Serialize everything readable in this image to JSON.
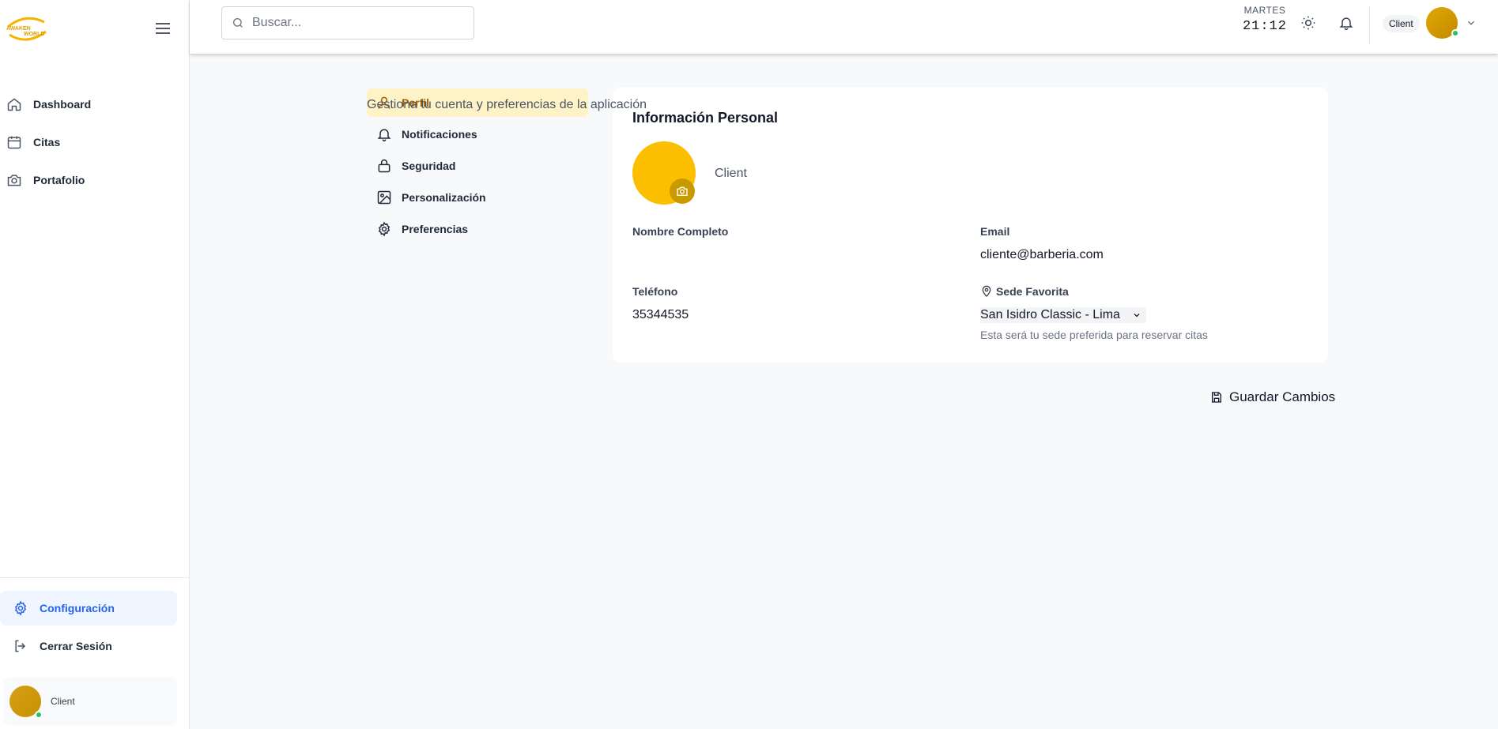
{
  "sidebar": {
    "logo_text": "AWAKEN WORLD",
    "items": [
      {
        "label": "Dashboard",
        "icon": "home-icon"
      },
      {
        "label": "Citas",
        "icon": "calendar-icon"
      },
      {
        "label": "Portafolio",
        "icon": "camera-icon"
      }
    ],
    "settings_label": "Configuración",
    "logout_label": "Cerrar Sesión",
    "user_name": "Client"
  },
  "header": {
    "search_placeholder": "Buscar...",
    "day": "MARTES",
    "time": "21:12",
    "role": "Client"
  },
  "page": {
    "subtitle": "Gestiona tu cuenta y preferencias de la aplicación"
  },
  "tabs": [
    {
      "label": "Perfil",
      "icon": "user-icon",
      "active": true
    },
    {
      "label": "Notificaciones",
      "icon": "bell-icon"
    },
    {
      "label": "Seguridad",
      "icon": "lock-icon"
    },
    {
      "label": "Personalización",
      "icon": "image-icon"
    },
    {
      "label": "Preferencias",
      "icon": "gear-icon"
    }
  ],
  "profile": {
    "title": "Información Personal",
    "avatar_name": "Client",
    "full_name_label": "Nombre Completo",
    "full_name_value": "",
    "email_label": "Email",
    "email_value": "cliente@barberia.com",
    "phone_label": "Teléfono",
    "phone_value": "35344535",
    "branch_label": "Sede Favorita",
    "branch_value": "San Isidro Classic - Lima",
    "branch_hint": "Esta será tu sede preferida para reservar citas"
  },
  "actions": {
    "save_label": "Guardar Cambios"
  },
  "colors": {
    "accent_yellow": "#fbbf00",
    "active_tab_bg": "#fef3c7",
    "active_blue": "#2563eb",
    "online_green": "#22c55e"
  }
}
